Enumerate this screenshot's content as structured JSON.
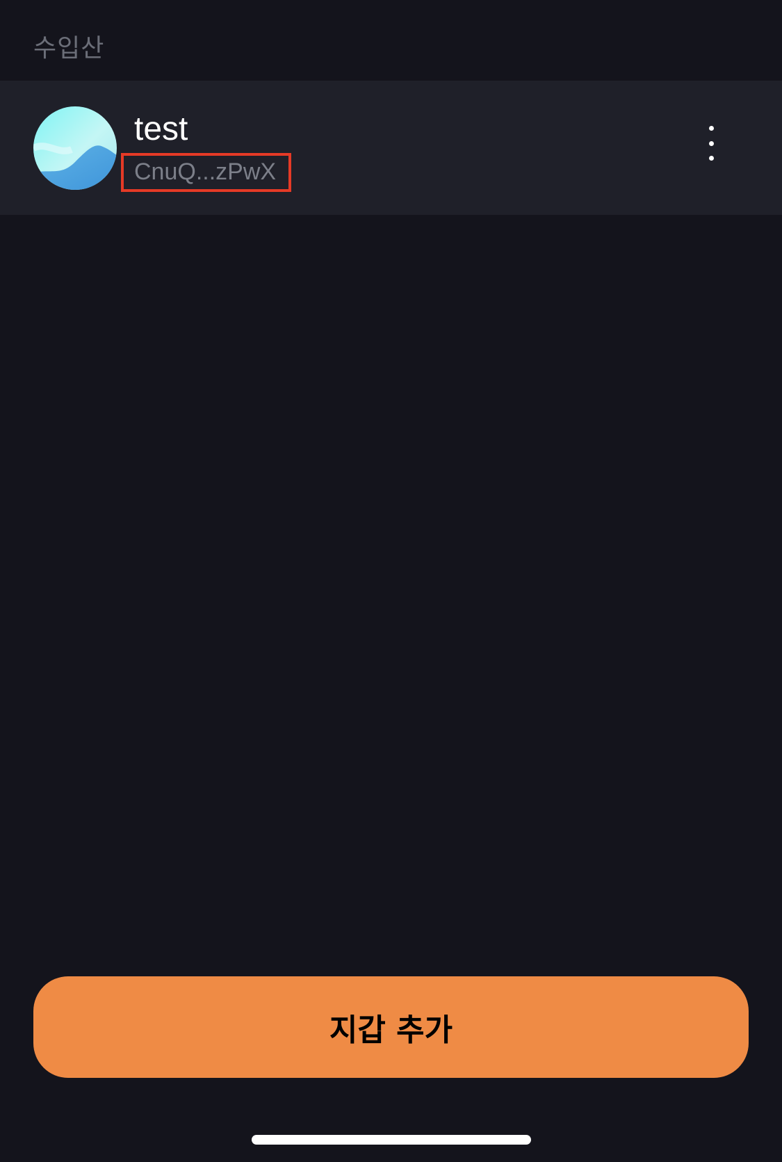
{
  "section": {
    "label": "수입산"
  },
  "wallet": {
    "name": "test",
    "address": "CnuQ...zPwX",
    "avatar_colors": [
      "#8ff5f4",
      "#c7f3f2",
      "#4a9ee0"
    ],
    "highlight_color": "#e53a26"
  },
  "actions": {
    "more_icon": "more-vertical-icon",
    "add_wallet_label": "지갑 추가"
  },
  "theme": {
    "background": "#14141c",
    "row_background": "#1f2029",
    "accent": "#ef8b45"
  }
}
